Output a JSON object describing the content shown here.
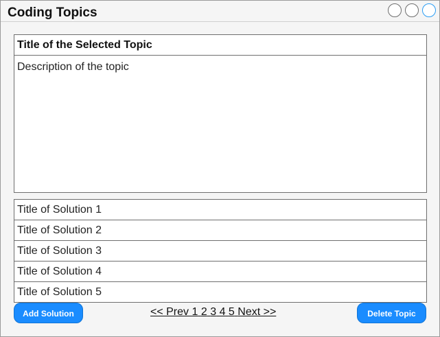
{
  "window": {
    "title": "Coding Topics",
    "controls": [
      "circle-button",
      "circle-button",
      "circle-button"
    ],
    "active_control_color": "#2a9df4"
  },
  "topic": {
    "title": "Title of the Selected Topic",
    "description": "Description of the topic"
  },
  "solutions": [
    "Title of Solution 1",
    "Title of Solution 2",
    "Title of Solution 3",
    "Title of Solution 4",
    "Title of Solution 5"
  ],
  "actions": {
    "add_label": "Add Solution",
    "delete_label": "Delete Topic",
    "button_color": "#1a8cff"
  },
  "pagination": {
    "prev": "<< Prev",
    "pages": [
      "1",
      "2",
      "3",
      "4",
      "5"
    ],
    "next": "Next >>"
  }
}
